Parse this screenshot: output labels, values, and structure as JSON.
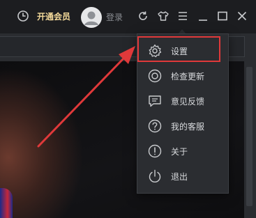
{
  "titlebar": {
    "vip_label": "开通会员",
    "login_label": "登录",
    "icons": [
      "clock-icon",
      "avatar",
      "refresh-icon",
      "skin-shirt-icon",
      "menu-icon",
      "minimize-icon",
      "maximize-icon",
      "close-icon"
    ]
  },
  "menu": {
    "items": [
      {
        "label": "设置",
        "icon": "gear-icon",
        "highlighted": true
      },
      {
        "label": "检查更新",
        "icon": "update-check-icon"
      },
      {
        "label": "意见反馈",
        "icon": "feedback-icon"
      },
      {
        "label": "我的客服",
        "icon": "help-icon"
      },
      {
        "label": "关于",
        "icon": "info-icon"
      },
      {
        "label": "退出",
        "icon": "power-icon"
      }
    ]
  },
  "colors": {
    "accent_gold": "#f3d99a",
    "highlight_red": "#e0393a",
    "menu_bg": "#2b2d31",
    "titlebar_bg": "#1c1d20"
  }
}
